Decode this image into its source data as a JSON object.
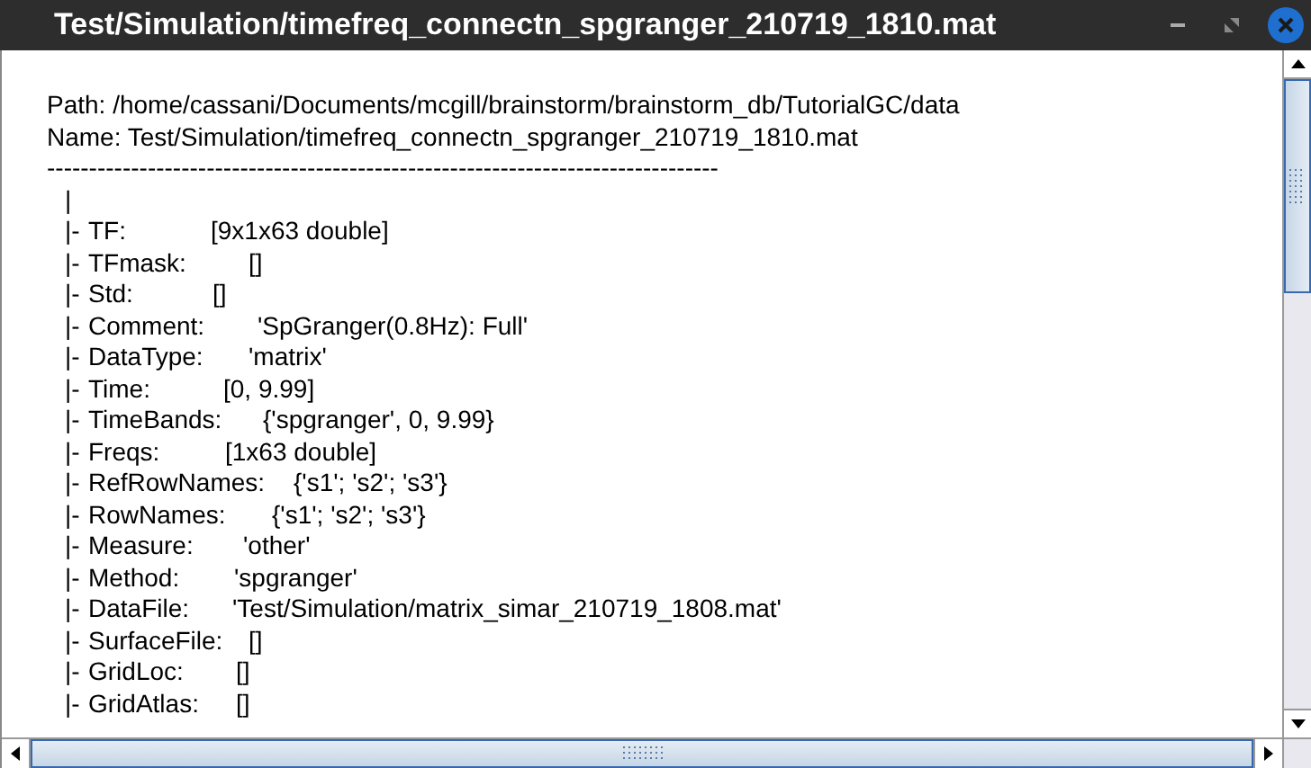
{
  "window": {
    "title": "Test/Simulation/timefreq_connectn_spgranger_210719_1810.mat"
  },
  "header": {
    "path": "Path: /home/cassani/Documents/mcgill/brainstorm/brainstorm_db/TutorialGC/data",
    "name": "Name: Test/Simulation/timefreq_connectn_spgranger_210719_1810.mat",
    "separator": "--------------------------------------------------------------------------------"
  },
  "tree": {
    "root": "|",
    "branch": "|-",
    "fields": [
      {
        "name": "TF:",
        "value": "[9x1x63 double]"
      },
      {
        "name": "TFmask:",
        "value": "[]"
      },
      {
        "name": "Std:",
        "value": "[]"
      },
      {
        "name": "Comment:",
        "value": "'SpGranger(0.8Hz): Full'"
      },
      {
        "name": "DataType:",
        "value": "'matrix'"
      },
      {
        "name": "Time:",
        "value": "[0, 9.99]"
      },
      {
        "name": "TimeBands:",
        "value": "{'spgranger', 0, 9.99}"
      },
      {
        "name": "Freqs:",
        "value": "[1x63 double]"
      },
      {
        "name": "RefRowNames:",
        "value": "{'s1'; 's2'; 's3'}"
      },
      {
        "name": "RowNames:",
        "value": "{'s1'; 's2'; 's3'}"
      },
      {
        "name": "Measure:",
        "value": "'other'"
      },
      {
        "name": "Method:",
        "value": "'spgranger'"
      },
      {
        "name": "DataFile:",
        "value": "'Test/Simulation/matrix_simar_210719_1808.mat'"
      },
      {
        "name": "SurfaceFile:",
        "value": "[]"
      },
      {
        "name": "GridLoc:",
        "value": "[]"
      },
      {
        "name": "GridAtlas:",
        "value": "[]"
      }
    ]
  }
}
